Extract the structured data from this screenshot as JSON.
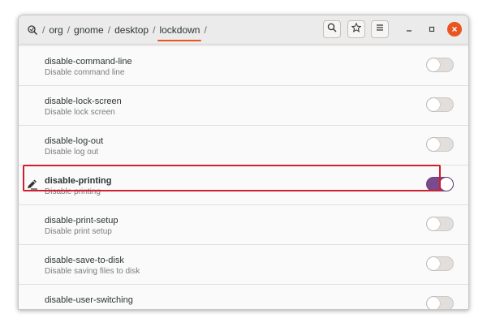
{
  "path": {
    "segments": [
      "org",
      "gnome",
      "desktop",
      "lockdown"
    ],
    "separator": "/"
  },
  "header_icons": {
    "root": "search-root-icon",
    "search": "search-icon",
    "bookmark": "star-icon",
    "menu": "hamburger-menu-icon",
    "minimize": "minimize-icon",
    "maximize": "maximize-icon",
    "close": "close-icon"
  },
  "rows": [
    {
      "name": "disable-command-line",
      "desc": "Disable command line",
      "on": false
    },
    {
      "name": "disable-lock-screen",
      "desc": "Disable lock screen",
      "on": false
    },
    {
      "name": "disable-log-out",
      "desc": "Disable log out",
      "on": false
    },
    {
      "name": "disable-printing",
      "desc": "Disable printing",
      "on": true,
      "modified": true
    },
    {
      "name": "disable-print-setup",
      "desc": "Disable print setup",
      "on": false
    },
    {
      "name": "disable-save-to-disk",
      "desc": "Disable saving files to disk",
      "on": false
    },
    {
      "name": "disable-user-switching",
      "desc": "",
      "on": false
    }
  ],
  "colors": {
    "accent": "#e95420",
    "toggle_on": "#7a4b8c",
    "highlight": "#d01f2e"
  }
}
